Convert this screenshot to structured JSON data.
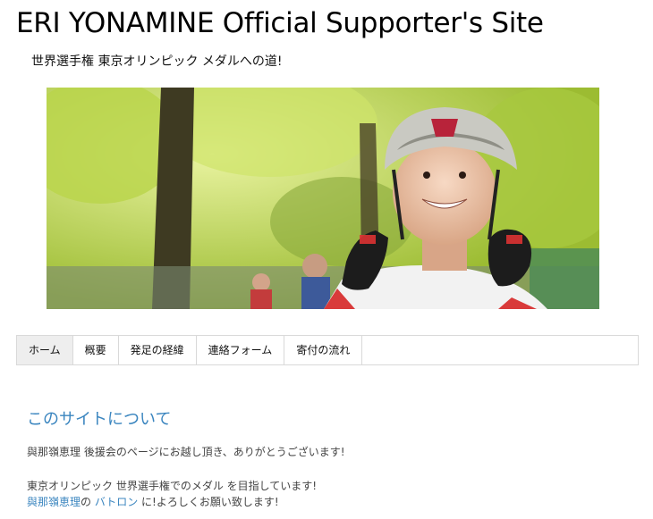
{
  "header": {
    "title": "ERI YONAMINE Official Supporter's Site",
    "tagline": "世界選手権 東京オリンピック メダルへの道!"
  },
  "nav": {
    "items": [
      {
        "label": "ホーム",
        "active": true
      },
      {
        "label": "概要",
        "active": false
      },
      {
        "label": "発足の経緯",
        "active": false
      },
      {
        "label": "連絡フォーム",
        "active": false
      },
      {
        "label": "寄付の流れ",
        "active": false
      }
    ]
  },
  "content": {
    "heading": "このサイトについて",
    "p1": "與那嶺恵理 後援会のページにお越し頂き、ありがとうございます!",
    "p2_line1": "東京オリンピック 世界選手権でのメダル を目指しています!",
    "p2_line2_link1": "與那嶺恵理",
    "p2_line2_text1": "の ",
    "p2_line2_link2": "バトロン",
    "p2_line2_text2": " に!よろしくお願い致します!"
  },
  "colors": {
    "link": "#3a85bf",
    "nav_border": "#d9d9d9",
    "nav_active_bg": "#eeeeee"
  }
}
